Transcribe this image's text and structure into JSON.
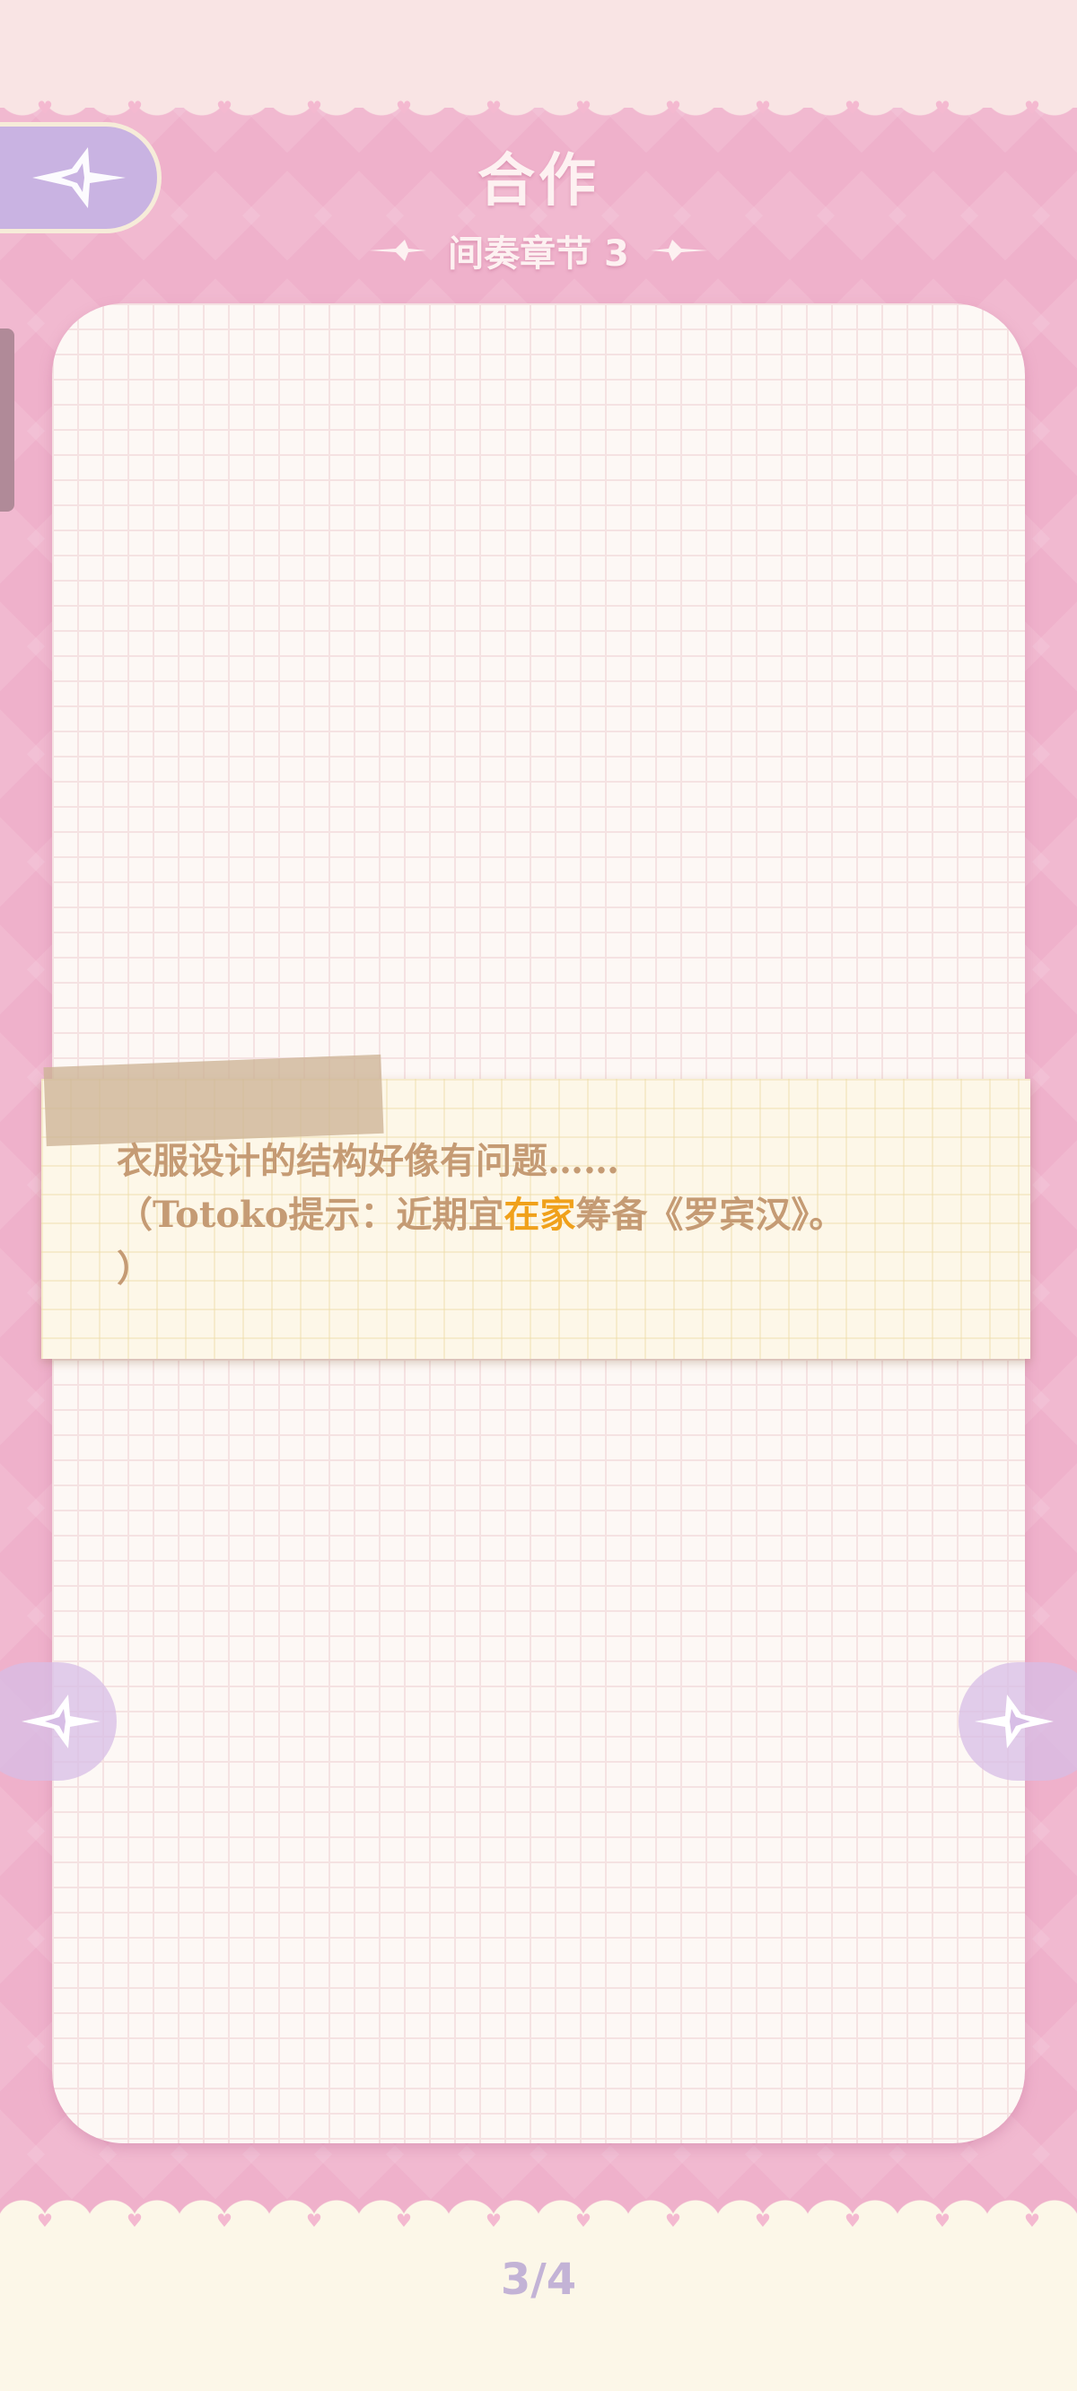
{
  "header": {
    "title": "合作",
    "subtitle": "间奏章节 3"
  },
  "note": {
    "line1": "衣服设计的结构好像有问题……",
    "line2_prefix": "（Totoko提示：近期宜",
    "line2_highlight": "在家",
    "line2_suffix": "筹备《罗宾汉》。",
    "line3": "）"
  },
  "pagination": {
    "label": "3/4"
  },
  "colors": {
    "background_pink": "#efb1cb",
    "card": "#fdf8f5",
    "note_text": "#c59b74",
    "highlight": "#f0a11b",
    "pager": "#c3b3d6"
  },
  "icons": {
    "back": "sparkle-back-icon",
    "prev": "sparkle-left-arrow-icon",
    "next": "sparkle-right-arrow-icon",
    "subtitle_ornament_left": "sparkle-ornament-icon",
    "subtitle_ornament_right": "sparkle-ornament-icon"
  }
}
